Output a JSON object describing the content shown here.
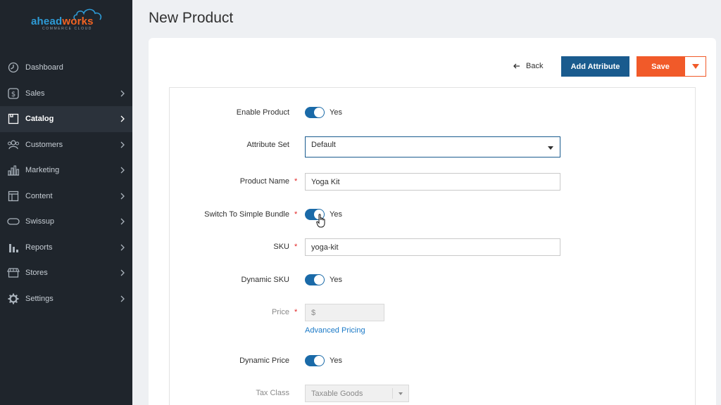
{
  "brand": {
    "name_part1": "ahead",
    "name_part2": "works",
    "tagline": "COMMERCE CLOUD"
  },
  "sidebar": {
    "items": [
      {
        "label": "Dashboard",
        "icon": "dashboard-icon",
        "has_chevron": false
      },
      {
        "label": "Sales",
        "icon": "dollar-icon",
        "has_chevron": true
      },
      {
        "label": "Catalog",
        "icon": "catalog-icon",
        "has_chevron": true,
        "active": true
      },
      {
        "label": "Customers",
        "icon": "customers-icon",
        "has_chevron": true
      },
      {
        "label": "Marketing",
        "icon": "marketing-icon",
        "has_chevron": true
      },
      {
        "label": "Content",
        "icon": "content-icon",
        "has_chevron": true
      },
      {
        "label": "Swissup",
        "icon": "swissup-icon",
        "has_chevron": true
      },
      {
        "label": "Reports",
        "icon": "reports-icon",
        "has_chevron": true
      },
      {
        "label": "Stores",
        "icon": "stores-icon",
        "has_chevron": true
      },
      {
        "label": "Settings",
        "icon": "gear-icon",
        "has_chevron": true
      }
    ]
  },
  "page": {
    "title": "New Product"
  },
  "toolbar": {
    "back_label": "Back",
    "add_attribute_label": "Add Attribute",
    "save_label": "Save"
  },
  "form": {
    "enable_product": {
      "label": "Enable Product",
      "value": "Yes"
    },
    "attribute_set": {
      "label": "Attribute Set",
      "value": "Default"
    },
    "product_name": {
      "label": "Product Name",
      "value": "Yoga Kit"
    },
    "simple_bundle": {
      "label": "Switch To Simple Bundle",
      "value": "Yes"
    },
    "sku": {
      "label": "SKU",
      "value": "yoga-kit"
    },
    "dynamic_sku": {
      "label": "Dynamic SKU",
      "value": "Yes"
    },
    "price": {
      "label": "Price",
      "value": "$",
      "advanced_link": "Advanced Pricing"
    },
    "dynamic_price": {
      "label": "Dynamic Price",
      "value": "Yes"
    },
    "tax_class": {
      "label": "Tax Class",
      "value": "Taxable Goods"
    },
    "required_mark": "*"
  },
  "colors": {
    "sidebar_bg": "#1f252c",
    "primary": "#1a5b8e",
    "accent": "#f15a29",
    "toggle_on": "#1a6aa8",
    "link": "#1a79c7"
  }
}
